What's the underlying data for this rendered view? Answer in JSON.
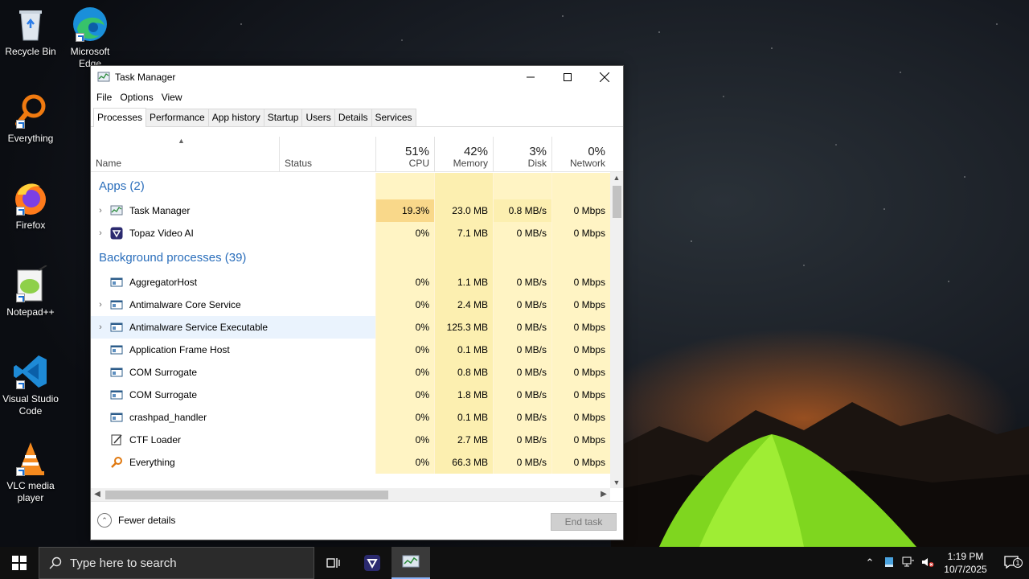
{
  "desktop": {
    "icons": [
      {
        "label": "Recycle Bin",
        "icon": "recycle-bin-icon"
      },
      {
        "label": "Microsoft Edge",
        "icon": "edge-icon"
      },
      {
        "label": "Everything",
        "icon": "everything-icon"
      },
      {
        "label": "Firefox",
        "icon": "firefox-icon"
      },
      {
        "label": "Notepad++",
        "icon": "notepadpp-icon"
      },
      {
        "label": "Visual Studio Code",
        "icon": "vscode-icon"
      },
      {
        "label": "VLC media player",
        "icon": "vlc-icon"
      }
    ]
  },
  "window": {
    "title": "Task Manager",
    "menu": [
      "File",
      "Options",
      "View"
    ],
    "tabs": [
      "Processes",
      "Performance",
      "App history",
      "Startup",
      "Users",
      "Details",
      "Services"
    ],
    "active_tab": "Processes",
    "columns": {
      "name": "Name",
      "status": "Status",
      "cpu": {
        "pct": "51%",
        "label": "CPU"
      },
      "memory": {
        "pct": "42%",
        "label": "Memory"
      },
      "disk": {
        "pct": "3%",
        "label": "Disk"
      },
      "network": {
        "pct": "0%",
        "label": "Network"
      }
    },
    "groups": {
      "apps": "Apps (2)",
      "background": "Background processes (39)"
    },
    "apps": [
      {
        "name": "Task Manager",
        "cpu": "19.3%",
        "memory": "23.0 MB",
        "disk": "0.8 MB/s",
        "network": "0 Mbps",
        "icon": "task-manager-icon"
      },
      {
        "name": "Topaz Video AI",
        "cpu": "0%",
        "memory": "7.1 MB",
        "disk": "0 MB/s",
        "network": "0 Mbps",
        "icon": "topaz-icon"
      }
    ],
    "background": [
      {
        "name": "AggregatorHost",
        "cpu": "0%",
        "memory": "1.1 MB",
        "disk": "0 MB/s",
        "network": "0 Mbps",
        "expand": false
      },
      {
        "name": "Antimalware Core Service",
        "cpu": "0%",
        "memory": "2.4 MB",
        "disk": "0 MB/s",
        "network": "0 Mbps",
        "expand": true
      },
      {
        "name": "Antimalware Service Executable",
        "cpu": "0%",
        "memory": "125.3 MB",
        "disk": "0 MB/s",
        "network": "0 Mbps",
        "expand": true
      },
      {
        "name": "Application Frame Host",
        "cpu": "0%",
        "memory": "0.1 MB",
        "disk": "0 MB/s",
        "network": "0 Mbps",
        "expand": false
      },
      {
        "name": "COM Surrogate",
        "cpu": "0%",
        "memory": "0.8 MB",
        "disk": "0 MB/s",
        "network": "0 Mbps",
        "expand": false
      },
      {
        "name": "COM Surrogate",
        "cpu": "0%",
        "memory": "1.8 MB",
        "disk": "0 MB/s",
        "network": "0 Mbps",
        "expand": false
      },
      {
        "name": "crashpad_handler",
        "cpu": "0%",
        "memory": "0.1 MB",
        "disk": "0 MB/s",
        "network": "0 Mbps",
        "expand": false
      },
      {
        "name": "CTF Loader",
        "cpu": "0%",
        "memory": "2.7 MB",
        "disk": "0 MB/s",
        "network": "0 Mbps",
        "expand": false
      },
      {
        "name": "Everything",
        "cpu": "0%",
        "memory": "66.3 MB",
        "disk": "0 MB/s",
        "network": "0 Mbps",
        "expand": false
      }
    ],
    "footer": {
      "fewer_details": "Fewer details",
      "end_task": "End task"
    }
  },
  "taskbar": {
    "search_placeholder": "Type here to search",
    "time": "1:19 PM",
    "date": "10/7/2025",
    "notification_count": "1"
  },
  "colors": {
    "accent": "#2a6ebb",
    "cpu_hot": "#f9d88a",
    "cell_light": "#fff4c4",
    "cell_mid": "#fcefb0"
  }
}
